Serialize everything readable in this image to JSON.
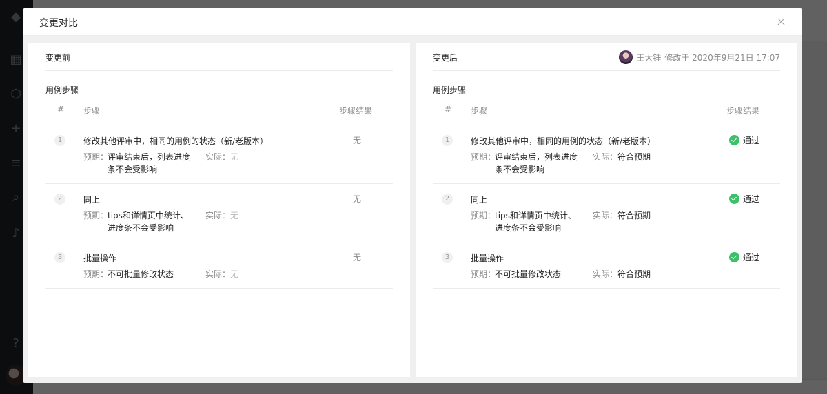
{
  "modal": {
    "title": "变更对比"
  },
  "before": {
    "title": "变更前",
    "section_title": "用例步骤",
    "columns": {
      "num": "#",
      "step": "步骤",
      "result": "步骤结果"
    },
    "expect_label": "预期：",
    "actual_label": "实际：",
    "rows": [
      {
        "num": "1",
        "step": "修改其他评审中，相同的用例的状态（新/老版本）",
        "expect": "评审结束后，列表进度条不会受影响",
        "actual": "无",
        "result": "无"
      },
      {
        "num": "2",
        "step": "同上",
        "expect": "tips和详情页中统计、进度条不会受影响",
        "actual": "无",
        "result": "无"
      },
      {
        "num": "3",
        "step": "批量操作",
        "expect": "不可批量修改状态",
        "actual": "无",
        "result": "无"
      }
    ]
  },
  "after": {
    "title": "变更后",
    "modified_by": "王大锤",
    "modified_text": "修改于 2020年9月21日 17:07",
    "section_title": "用例步骤",
    "columns": {
      "num": "#",
      "step": "步骤",
      "result": "步骤结果"
    },
    "expect_label": "预期：",
    "actual_label": "实际：",
    "rows": [
      {
        "num": "1",
        "step": "修改其他评审中，相同的用例的状态（新/老版本）",
        "expect": "评审结束后，列表进度条不会受影响",
        "actual": "符合预期",
        "result": "通过"
      },
      {
        "num": "2",
        "step": "同上",
        "expect": "tips和详情页中统计、进度条不会受影响",
        "actual": "符合预期",
        "result": "通过"
      },
      {
        "num": "3",
        "step": "批量操作",
        "expect": "不可批量修改状态",
        "actual": "符合预期",
        "result": "通过"
      }
    ]
  },
  "colors": {
    "pass": "#3cc16a",
    "overlay": "rgba(0,0,0,0.62)"
  }
}
